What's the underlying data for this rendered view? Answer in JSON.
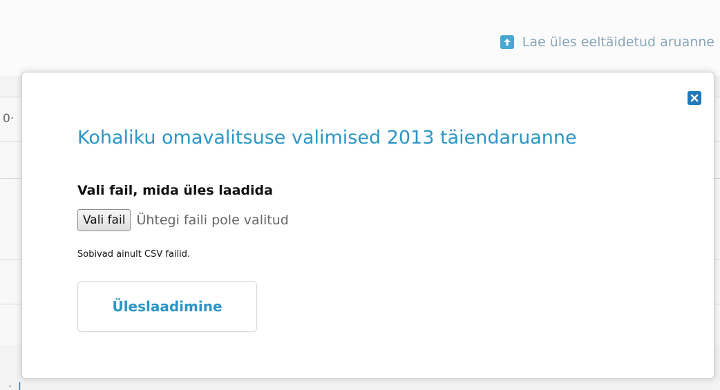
{
  "header": {
    "upload_prefilled_link": "Lae üles eeltäidetud aruanne",
    "upload_icon": "arrow-up-icon"
  },
  "background": {
    "stub_text": "0·",
    "bottom_text": "· I"
  },
  "modal": {
    "close_icon": "close-icon",
    "title": "Kohaliku omavalitsuse valimised 2013 täiendaruanne",
    "file_label": "Vali fail, mida üles laadida",
    "file_button": "Vali fail",
    "file_status": "Ühtegi faili pole valitud",
    "hint": "Sobivad ainult CSV failid.",
    "submit_button": "Üleslaadimine"
  },
  "colors": {
    "accent": "#2b96c5",
    "close_button": "#1f79ba",
    "upload_icon_bg": "#49a6d1"
  }
}
